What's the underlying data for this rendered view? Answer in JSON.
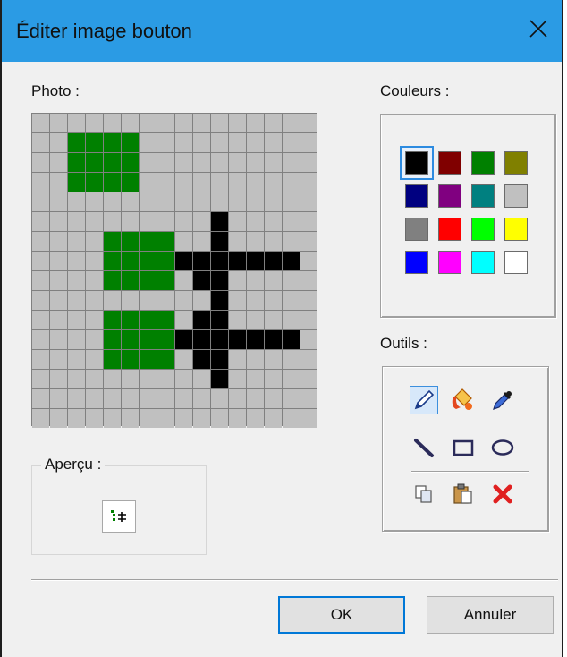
{
  "window": {
    "title": "Éditer image bouton"
  },
  "photo": {
    "label": "Photo :",
    "grid_size": 16,
    "pixels": [
      {
        "color": "#008000",
        "cells": [
          [
            2,
            1
          ],
          [
            3,
            1
          ],
          [
            4,
            1
          ],
          [
            5,
            1
          ],
          [
            2,
            2
          ],
          [
            3,
            2
          ],
          [
            4,
            2
          ],
          [
            5,
            2
          ],
          [
            2,
            3
          ],
          [
            3,
            3
          ],
          [
            4,
            3
          ],
          [
            5,
            3
          ],
          [
            4,
            6
          ],
          [
            5,
            6
          ],
          [
            6,
            6
          ],
          [
            7,
            6
          ],
          [
            4,
            7
          ],
          [
            5,
            7
          ],
          [
            6,
            7
          ],
          [
            7,
            7
          ],
          [
            4,
            8
          ],
          [
            5,
            8
          ],
          [
            6,
            8
          ],
          [
            7,
            8
          ],
          [
            4,
            10
          ],
          [
            5,
            10
          ],
          [
            6,
            10
          ],
          [
            7,
            10
          ],
          [
            4,
            11
          ],
          [
            5,
            11
          ],
          [
            6,
            11
          ],
          [
            7,
            11
          ],
          [
            4,
            12
          ],
          [
            5,
            12
          ],
          [
            6,
            12
          ],
          [
            7,
            12
          ]
        ]
      },
      {
        "color": "#000000",
        "cells": [
          [
            10,
            5
          ],
          [
            10,
            6
          ],
          [
            9,
            7
          ],
          [
            10,
            7
          ],
          [
            11,
            7
          ],
          [
            12,
            7
          ],
          [
            13,
            7
          ],
          [
            14,
            7
          ],
          [
            8,
            7
          ],
          [
            10,
            8
          ],
          [
            9,
            8
          ],
          [
            10,
            9
          ],
          [
            9,
            10
          ],
          [
            10,
            10
          ],
          [
            8,
            11
          ],
          [
            9,
            11
          ],
          [
            10,
            11
          ],
          [
            11,
            11
          ],
          [
            12,
            11
          ],
          [
            13,
            11
          ],
          [
            14,
            11
          ],
          [
            9,
            12
          ],
          [
            10,
            12
          ],
          [
            10,
            13
          ]
        ]
      }
    ]
  },
  "colors": {
    "label": "Couleurs :",
    "swatches": [
      "#000000",
      "#800000",
      "#008000",
      "#808000",
      "#000080",
      "#800080",
      "#008080",
      "#c0c0c0",
      "#808080",
      "#ff0000",
      "#00ff00",
      "#ffff00",
      "#0000ff",
      "#ff00ff",
      "#00ffff",
      "#ffffff"
    ],
    "selected_index": 0
  },
  "tools": {
    "label": "Outils :",
    "items": [
      "pencil-icon",
      "fill-bucket-icon",
      "eyedropper-icon",
      "line-icon",
      "rectangle-icon",
      "ellipse-icon",
      "copy-icon",
      "paste-icon",
      "delete-icon"
    ],
    "selected": "pencil-icon"
  },
  "preview": {
    "label": "Aperçu :"
  },
  "buttons": {
    "ok": "OK",
    "cancel": "Annuler"
  }
}
